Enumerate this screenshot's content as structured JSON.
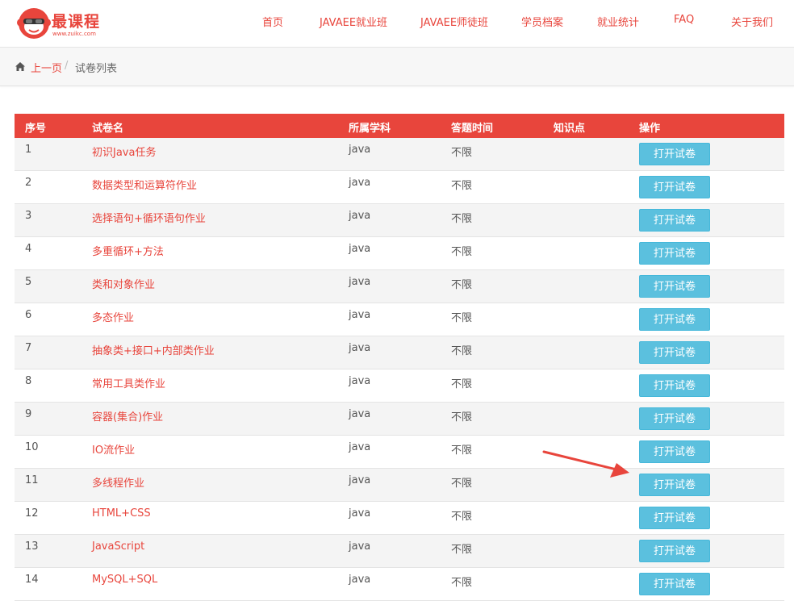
{
  "header": {
    "logo_name": "最课程",
    "logo_url": "www.zuikc.com",
    "nav": [
      {
        "label": "首页"
      },
      {
        "label": "JAVAEE就业班"
      },
      {
        "label": "JAVAEE师徒班"
      },
      {
        "label": "学员档案"
      },
      {
        "label": "就业统计"
      },
      {
        "label": "FAQ"
      },
      {
        "label": "关于我们"
      }
    ]
  },
  "breadcrumb": {
    "back_label": "上一页",
    "separator": "/",
    "current": "试卷列表",
    "icon": "home-icon"
  },
  "table": {
    "columns": [
      "序号",
      "试卷名",
      "所属学科",
      "答题时间",
      "知识点",
      "操作"
    ],
    "button_label": "打开试卷",
    "rows": [
      {
        "num": "1",
        "name": "初识Java任务",
        "subject": "java",
        "time": "不限",
        "knowledge": "",
        "action": "打开试卷"
      },
      {
        "num": "2",
        "name": "数据类型和运算符作业",
        "subject": "java",
        "time": "不限",
        "knowledge": "",
        "action": "打开试卷"
      },
      {
        "num": "3",
        "name": "选择语句+循环语句作业",
        "subject": "java",
        "time": "不限",
        "knowledge": "",
        "action": "打开试卷"
      },
      {
        "num": "4",
        "name": "多重循环+方法",
        "subject": "java",
        "time": "不限",
        "knowledge": "",
        "action": "打开试卷"
      },
      {
        "num": "5",
        "name": "类和对象作业",
        "subject": "java",
        "time": "不限",
        "knowledge": "",
        "action": "打开试卷"
      },
      {
        "num": "6",
        "name": "多态作业",
        "subject": "java",
        "time": "不限",
        "knowledge": "",
        "action": "打开试卷"
      },
      {
        "num": "7",
        "name": "抽象类+接口+内部类作业",
        "subject": "java",
        "time": "不限",
        "knowledge": "",
        "action": "打开试卷"
      },
      {
        "num": "8",
        "name": "常用工具类作业",
        "subject": "java",
        "time": "不限",
        "knowledge": "",
        "action": "打开试卷"
      },
      {
        "num": "9",
        "name": "容器(集合)作业",
        "subject": "java",
        "time": "不限",
        "knowledge": "",
        "action": "打开试卷"
      },
      {
        "num": "10",
        "name": "IO流作业",
        "subject": "java",
        "time": "不限",
        "knowledge": "",
        "action": "打开试卷"
      },
      {
        "num": "11",
        "name": "多线程作业",
        "subject": "java",
        "time": "不限",
        "knowledge": "",
        "action": "打开试卷"
      },
      {
        "num": "12",
        "name": "HTML+CSS",
        "subject": "java",
        "time": "不限",
        "knowledge": "",
        "action": "打开试卷"
      },
      {
        "num": "13",
        "name": "JavaScript",
        "subject": "java",
        "time": "不限",
        "knowledge": "",
        "action": "打开试卷"
      },
      {
        "num": "14",
        "name": "MySQL+SQL",
        "subject": "java",
        "time": "不限",
        "knowledge": "",
        "action": "打开试卷"
      }
    ]
  },
  "colors": {
    "brand_red": "#e8453c",
    "button_blue": "#5bc0de",
    "annotation_arrow": "#e8453c"
  }
}
